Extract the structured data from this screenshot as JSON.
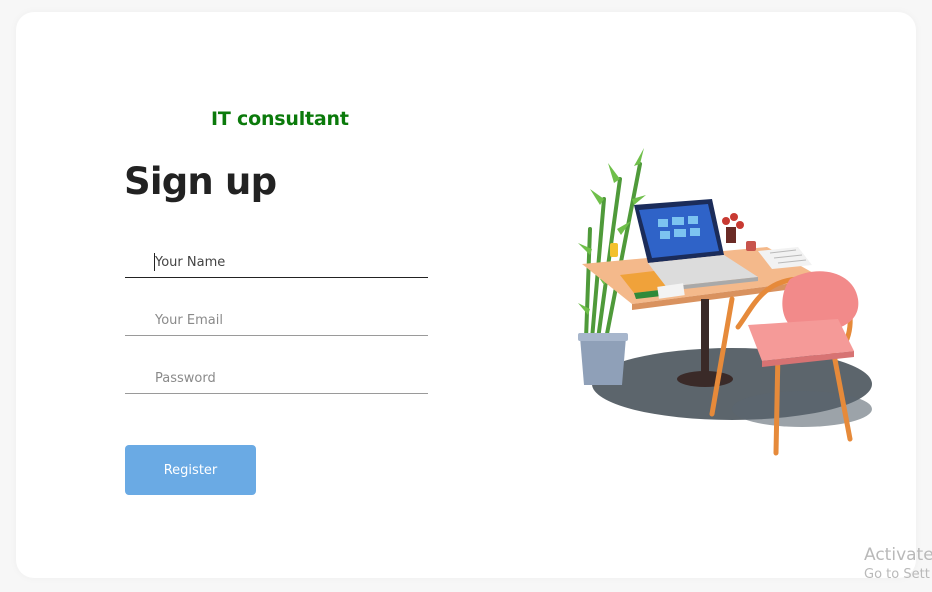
{
  "brand": {
    "name": "IT consultant",
    "color": "#0b7a0b"
  },
  "form": {
    "title": "Sign up",
    "fields": {
      "name": {
        "value": "",
        "placeholder": "Your Name"
      },
      "email": {
        "value": "",
        "placeholder": "Your Email"
      },
      "password": {
        "value": "",
        "placeholder": "Password"
      }
    },
    "submit_label": "Register",
    "submit_color": "#6aaae4"
  },
  "illustration": {
    "icon": "desk-workspace-illustration"
  },
  "watermark": {
    "line1": "Activate",
    "line2": "Go to Sett"
  }
}
